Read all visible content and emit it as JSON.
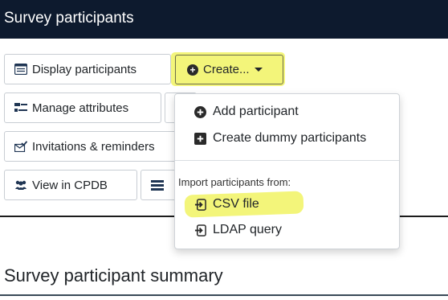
{
  "header": {
    "title": "Survey participants"
  },
  "toolbar": {
    "display_label": "Display participants",
    "create_label": "Create...",
    "manage_label": "Manage attributes",
    "invitations_label": "Invitations & reminders",
    "cpdb_label": "View in CPDB"
  },
  "create_menu": {
    "add_participant": "Add participant",
    "create_dummy": "Create dummy participants",
    "import_header": "Import participants from:",
    "csv_file": "CSV file",
    "ldap_query": "LDAP query"
  },
  "main": {
    "summary_title": "Survey participant summary"
  },
  "colors": {
    "header_bg": "#0d1a2e",
    "highlight": "#f3f57a"
  }
}
